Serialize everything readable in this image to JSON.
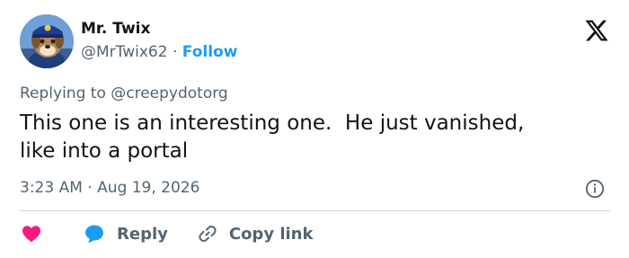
{
  "author": {
    "name": "Mr. Twix",
    "handle": "@MrTwix62",
    "separator": "·",
    "follow_label": "Follow",
    "avatar_icon": "police-dog-cartoon-avatar"
  },
  "reply_context": {
    "prefix": "Replying to",
    "mention": "@creepydotorg"
  },
  "tweet": {
    "line1": "This one is an interesting one.  He just vanished,",
    "line2": "like into a portal"
  },
  "meta": {
    "time": "3:23 AM",
    "separator": "·",
    "date": "Aug 19, 2026"
  },
  "actions": {
    "reply_label": "Reply",
    "copy_link_label": "Copy link"
  },
  "colors": {
    "accent": "#1d9bf0",
    "heart": "#f91880",
    "secondary_text": "#536471",
    "text": "#0f1419",
    "divider": "#cfd9de"
  }
}
